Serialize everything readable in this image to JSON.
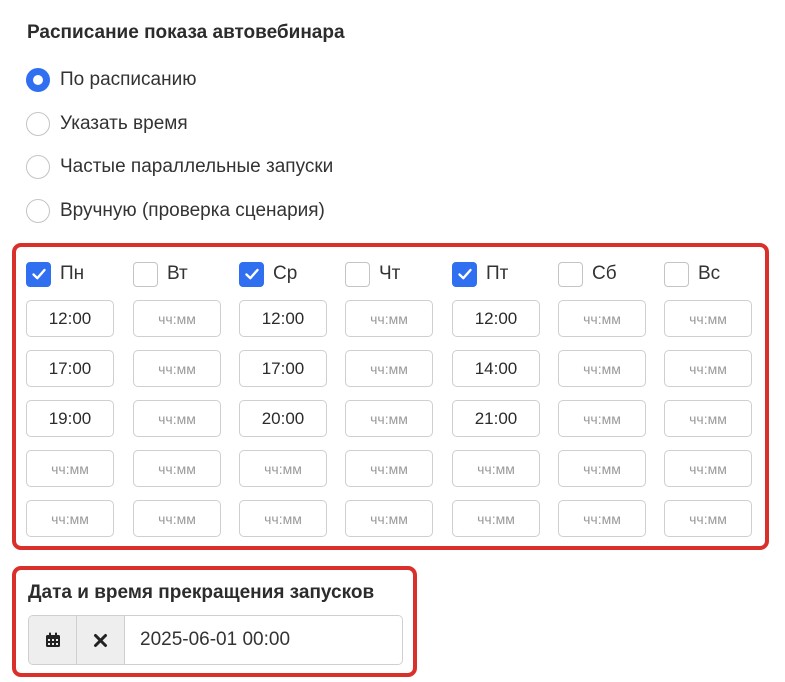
{
  "schedule_section": {
    "title": "Расписание показа автовебинара",
    "modes": [
      {
        "label": "По расписанию",
        "selected": true
      },
      {
        "label": "Указать время",
        "selected": false
      },
      {
        "label": "Частые параллельные запуски",
        "selected": false
      },
      {
        "label": "Вручную (проверка сценария)",
        "selected": false
      }
    ]
  },
  "time_placeholder": "чч:мм",
  "days": [
    {
      "key": "mon",
      "label": "Пн",
      "checked": true,
      "times": [
        "12:00",
        "17:00",
        "19:00",
        "",
        ""
      ]
    },
    {
      "key": "tue",
      "label": "Вт",
      "checked": false,
      "times": [
        "",
        "",
        "",
        "",
        ""
      ]
    },
    {
      "key": "wed",
      "label": "Ср",
      "checked": true,
      "times": [
        "12:00",
        "17:00",
        "20:00",
        "",
        ""
      ]
    },
    {
      "key": "thu",
      "label": "Чт",
      "checked": false,
      "times": [
        "",
        "",
        "",
        "",
        ""
      ]
    },
    {
      "key": "fri",
      "label": "Пт",
      "checked": true,
      "times": [
        "12:00",
        "14:00",
        "21:00",
        "",
        ""
      ]
    },
    {
      "key": "sat",
      "label": "Сб",
      "checked": false,
      "times": [
        "",
        "",
        "",
        "",
        ""
      ]
    },
    {
      "key": "sun",
      "label": "Вс",
      "checked": false,
      "times": [
        "",
        "",
        "",
        "",
        ""
      ]
    }
  ],
  "stop_section": {
    "title": "Дата и время прекращения запусков",
    "datetime_value": "2025-06-01 00:00"
  },
  "colors": {
    "accent": "#2f6ff0",
    "highlight_border": "#d9302c"
  },
  "icons": {
    "calendar": "calendar-icon",
    "clear": "close-icon",
    "checkmark": "checkmark-icon"
  }
}
